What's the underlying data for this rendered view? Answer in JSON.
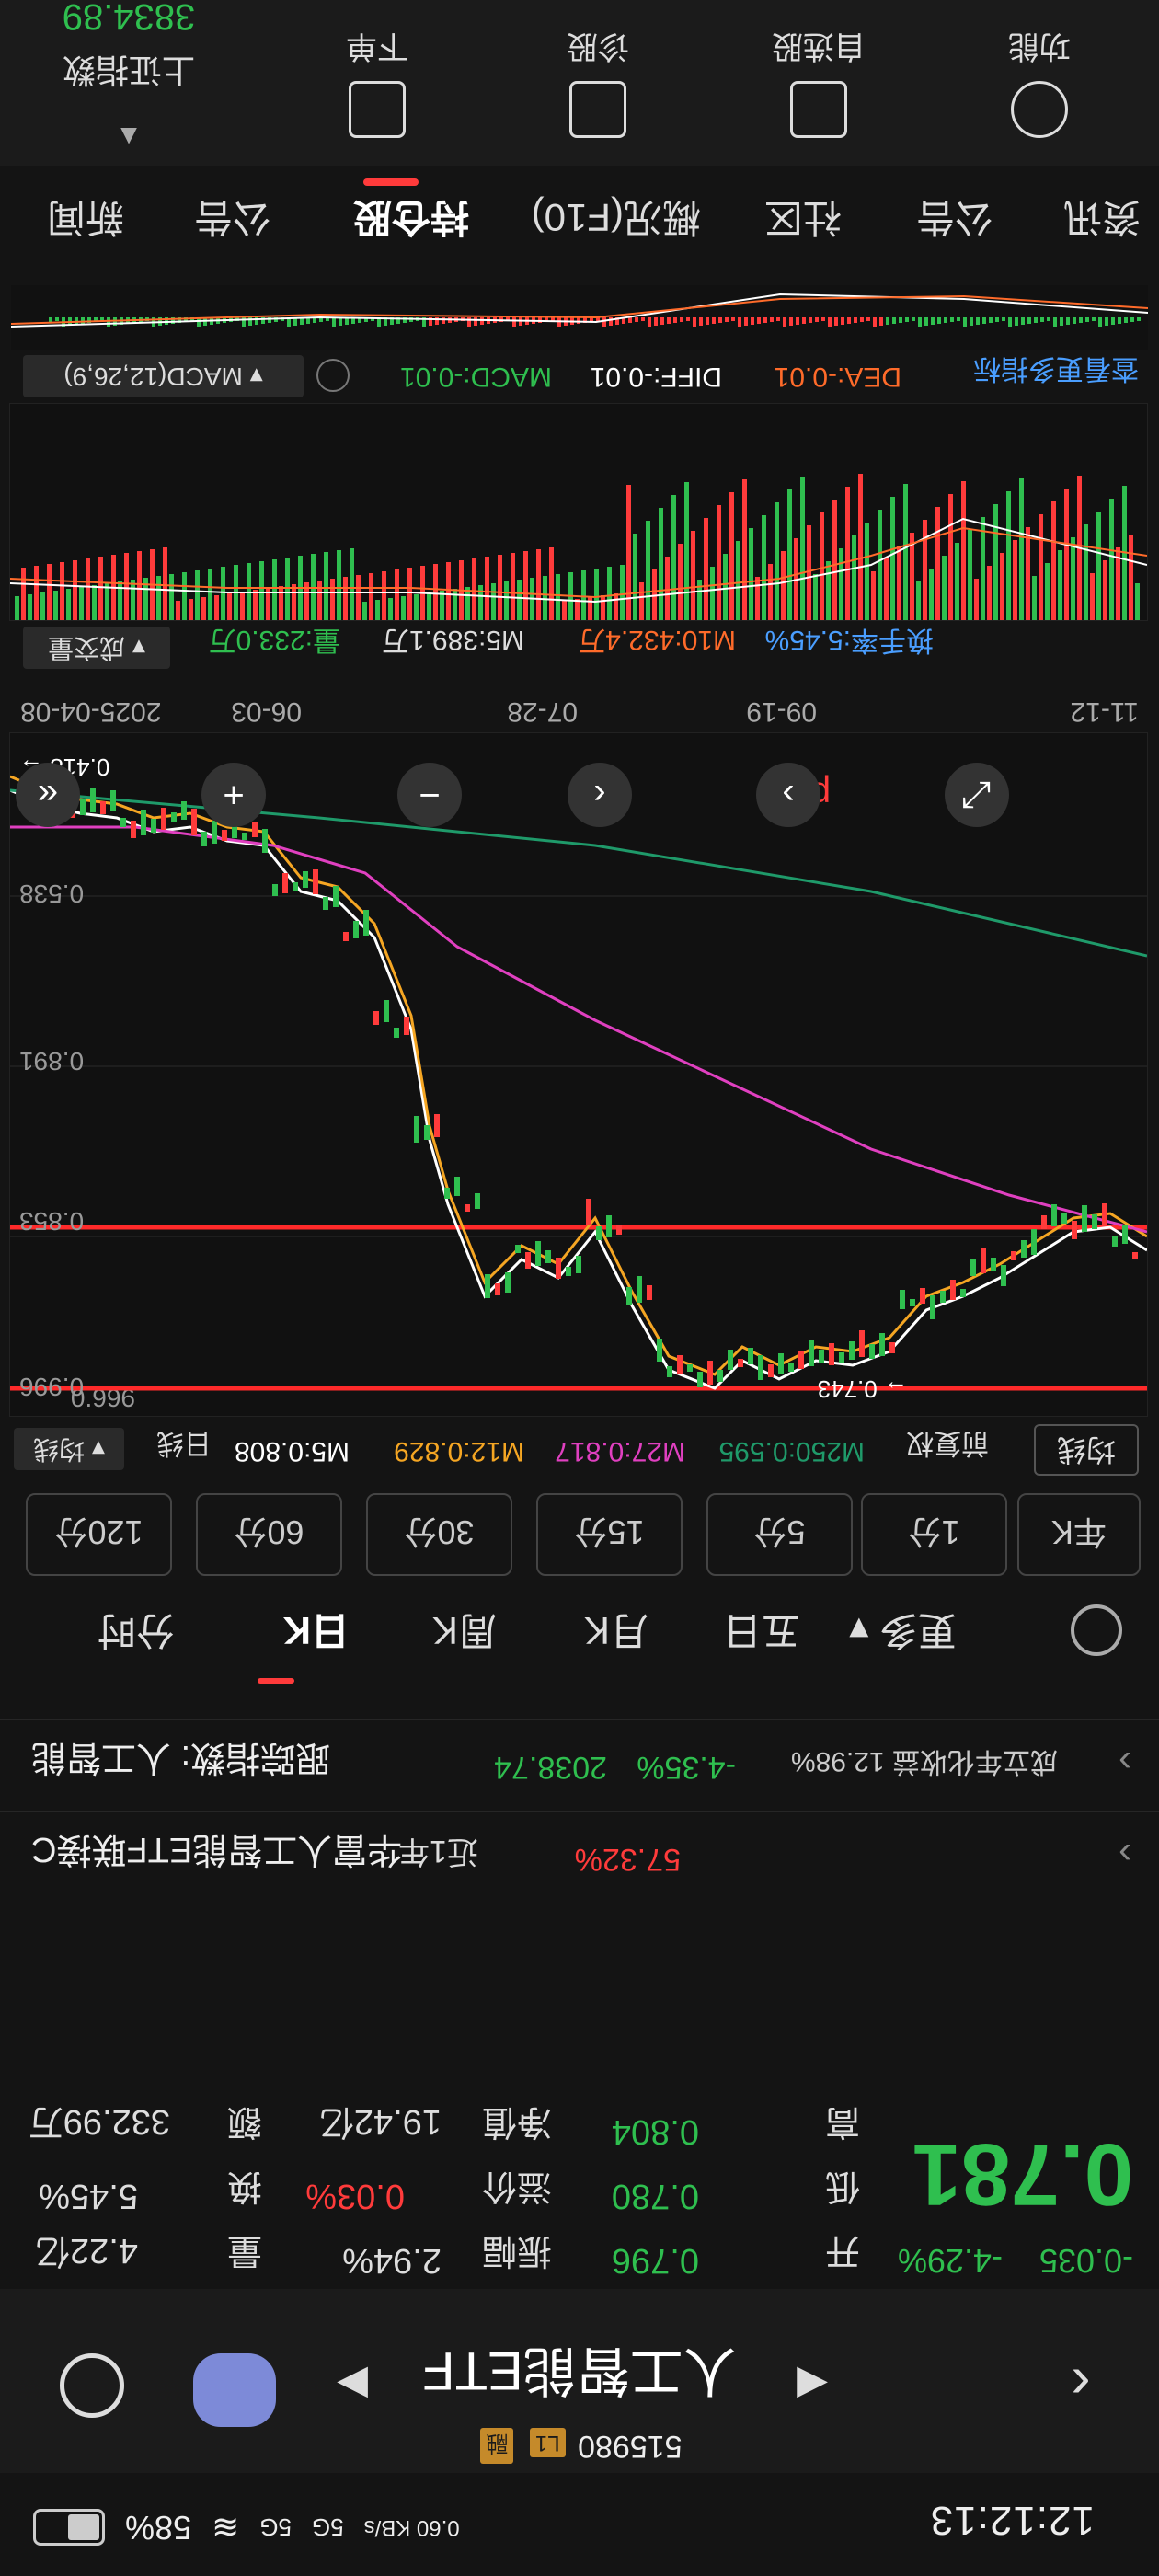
{
  "status_bar": {
    "time": "12:12:13",
    "network": "0.60 KB/s",
    "signal1": "5G",
    "signal2": "5G",
    "battery": "58%"
  },
  "header": {
    "stock_name": "人工智能ETF",
    "stock_code": "515980",
    "tag_1": "L1",
    "tag_2": "融"
  },
  "quote": {
    "price": "0.781",
    "change": "-0.035",
    "change_pct": "-4.29%",
    "open_label": "开",
    "open_value": "0.796",
    "low_label": "低",
    "low_value": "0.780",
    "high_label": "高",
    "high_value": "0.804",
    "amplitude_label": "振幅",
    "amplitude_value": "2.94%",
    "premium_label": "溢价",
    "premium_value": "0.03%",
    "net_value_label": "净值",
    "net_value_value": "19.42亿",
    "volume_label": "量",
    "volume_value": "4.22亿",
    "turnover_label": "换",
    "turnover_value": "5.45%",
    "amount_label": "额",
    "amount_value": "332.99万"
  },
  "links": {
    "fund_name": "华富人工智能ETF联接C",
    "fund_year_label": "近1年",
    "fund_year_value": "57.32%",
    "index_name": "跟踪指数: 人工智能",
    "index_value": "2038.74",
    "index_change": "-4.35%",
    "index_extra": "成立年化收益 12.98%"
  },
  "period_tabs": {
    "items": [
      "分时",
      "日K",
      "周K",
      "月K",
      "五日",
      "更多"
    ],
    "active": "日K"
  },
  "intervals": [
    "年K",
    "1分",
    "5分",
    "15分",
    "30分",
    "60分",
    "120分"
  ],
  "kline_legend": {
    "indicator": "均线",
    "type": "日线",
    "m5": "M5:0.808",
    "m12": "M12:0.829",
    "m27": "M27:0.817",
    "m250": "M250:0.595",
    "restore": "前复权",
    "tab": "均线"
  },
  "kline_axis": {
    "y1": "0.996",
    "y2": "0.853",
    "y3": "0.891",
    "y4": "0.538",
    "low_label": "0.743",
    "high_label": "0.418",
    "d1": "2025-04-08",
    "d2": "06-03",
    "d3": "07-28",
    "d4": "09-19",
    "d5": "11-12"
  },
  "volume_legend": {
    "indicator": "成交量",
    "vol": "量:233.0万",
    "m5": "M5:389.1万",
    "m10": "M10:432.4万",
    "turnover": "换手率:5.45%"
  },
  "macd_legend": {
    "indicator": "MACD(12,26,9)",
    "macd": "MACD:-0.01",
    "diff": "DIFF:-0.01",
    "dea": "DEA:-0.01",
    "tip": "查看更多指标"
  },
  "tabs": {
    "items": [
      "新闻",
      "公告",
      "持仓股",
      "概况(F10)",
      "社区",
      "公告",
      "资讯"
    ],
    "active": "持仓股"
  },
  "topbar": {
    "index_value": "3834.89",
    "index_name": "上证指数",
    "btn_1": "下单",
    "btn_2": "诊股",
    "btn_3": "自选股",
    "btn_4": "功能"
  },
  "colors": {
    "up": "#ff3b3b",
    "down": "#2fbf4f",
    "ma5": "#ffffff",
    "ma12": "#f5a623",
    "ma27": "#e040c0",
    "ma250": "#1f9a6a"
  }
}
